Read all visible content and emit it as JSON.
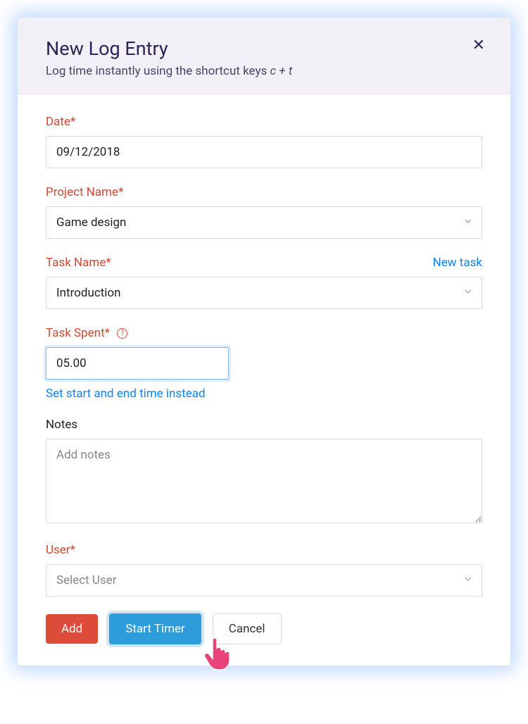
{
  "header": {
    "title": "New Log Entry",
    "subtitle_prefix": "Log time instantly using the shortcut keys ",
    "subtitle_shortcut": "c + t"
  },
  "fields": {
    "date": {
      "label": "Date*",
      "value": "09/12/2018"
    },
    "project_name": {
      "label": "Project Name*",
      "value": "Game design"
    },
    "task_name": {
      "label": "Task Name*",
      "new_task_link": "New task",
      "value": "Introduction"
    },
    "task_spent": {
      "label": "Task Spent*",
      "value": "05.00",
      "alt_link": "Set start and end time instead"
    },
    "notes": {
      "label": "Notes",
      "placeholder": "Add notes"
    },
    "user": {
      "label": "User*",
      "placeholder": "Select User"
    }
  },
  "buttons": {
    "add": "Add",
    "start_timer": "Start Timer",
    "cancel": "Cancel"
  }
}
